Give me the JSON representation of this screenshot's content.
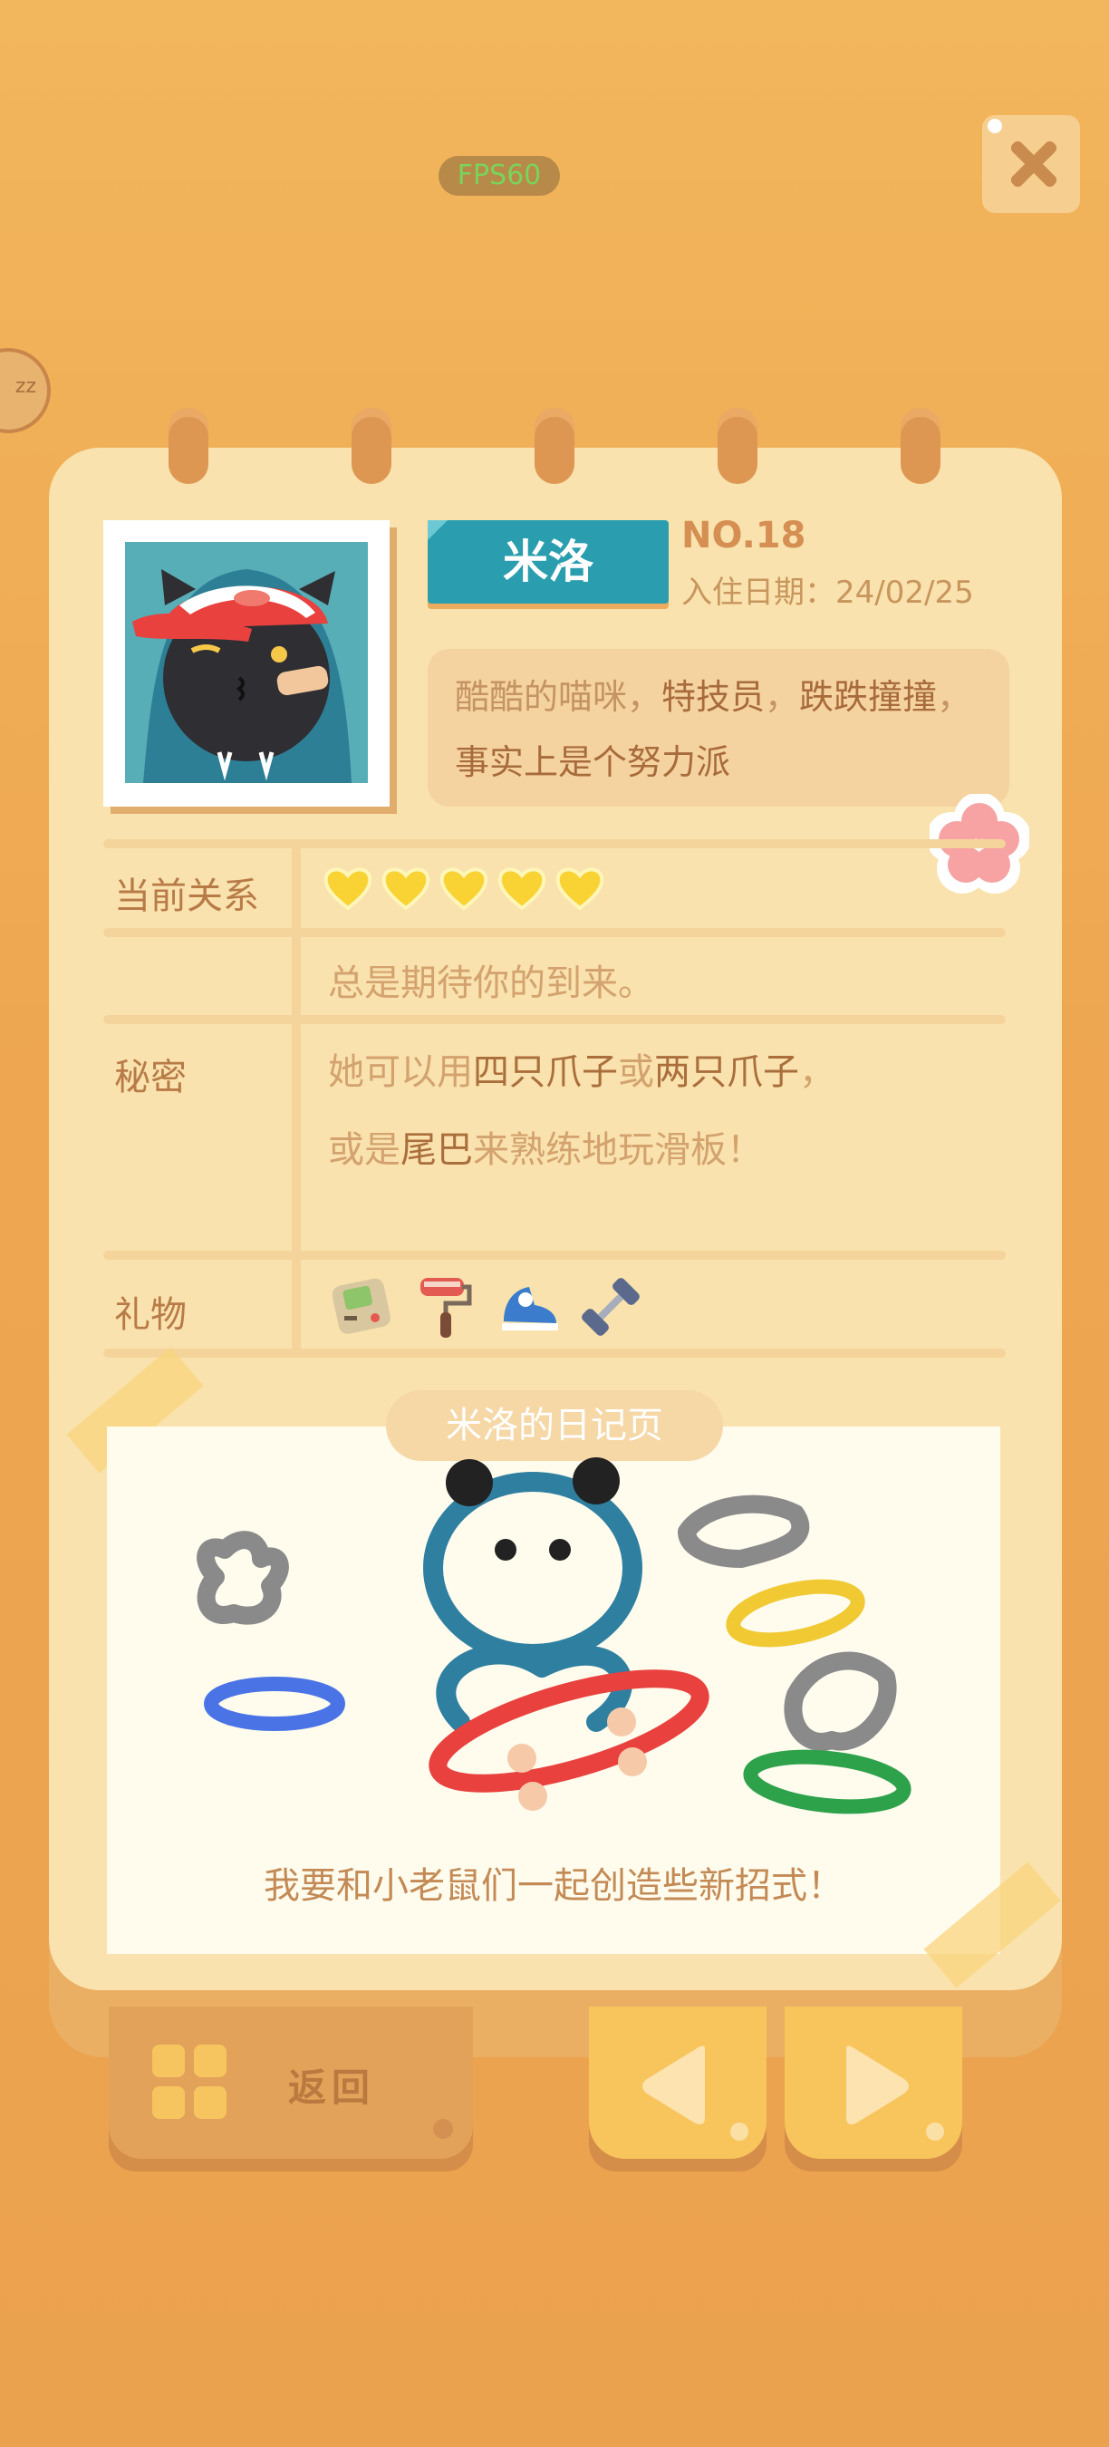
{
  "hud": {
    "fps": "FPS60",
    "sleep_badge": "zz"
  },
  "card": {
    "name": "米洛",
    "number": "NO.18",
    "checkin_date": "入住日期：24/02/25",
    "description": {
      "line1": [
        {
          "t": "酷酷的喵咪，",
          "strong": false
        },
        {
          "t": "特技员",
          "strong": true
        },
        {
          "t": "，",
          "strong": false
        },
        {
          "t": "跌跌撞撞",
          "strong": true
        },
        {
          "t": "，",
          "strong": false
        }
      ],
      "line2": [
        {
          "t": "事实上是个努力派",
          "strong": true
        }
      ]
    },
    "relationship": {
      "label": "当前关系",
      "hearts": 5,
      "heart_color": "#f9d233",
      "text": "总是期待你的到来。"
    },
    "secret": {
      "label": "秘密",
      "line1": [
        {
          "t": "她可以用",
          "strong": false
        },
        {
          "t": "四只爪子",
          "strong": true
        },
        {
          "t": "或",
          "strong": false
        },
        {
          "t": "两只爪子",
          "strong": true
        },
        {
          "t": "，",
          "strong": false
        }
      ],
      "line2": [
        {
          "t": "或是",
          "strong": false
        },
        {
          "t": "尾巴",
          "strong": true
        },
        {
          "t": "来熟练地玩滑板！",
          "strong": false
        }
      ]
    },
    "gifts": {
      "label": "礼物",
      "items": [
        "handheld-game-console-icon",
        "paint-roller-icon",
        "sneaker-icon",
        "dumbbell-icon"
      ]
    },
    "diary": {
      "title": "米洛的日记页",
      "caption": "我要和小老鼠们一起创造些新招式！"
    }
  },
  "buttons": {
    "back": "返回",
    "prev": "previous-arrow",
    "next": "next-arrow"
  },
  "colors": {
    "accent_teal": "#2a9eae",
    "paper": "#f9e2ad",
    "button_yellow": "#f8c55c",
    "text_brown": "#b87b47"
  }
}
